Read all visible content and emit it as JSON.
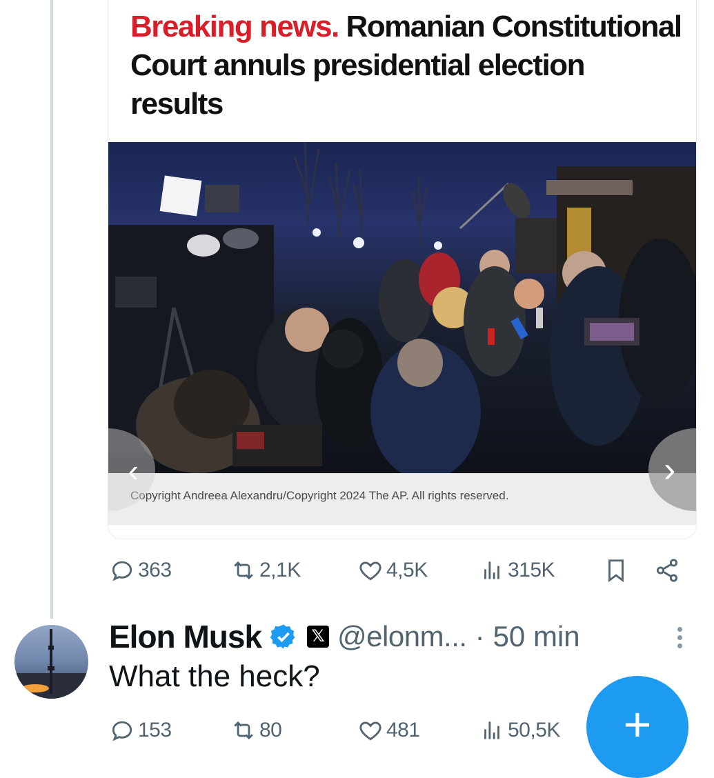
{
  "article": {
    "headline_accent": "Breaking news.",
    "headline_rest": " Romanian Constitutional Court annuls presidential election results",
    "caption": "Copyright Andreea Alexandru/Copyright 2024 The AP. All rights reserved."
  },
  "post_stats": {
    "replies": "363",
    "reposts": "2,1K",
    "likes": "4,5K",
    "views": "315K"
  },
  "reply": {
    "name": "Elon Musk",
    "badge_letter": "𝕏",
    "handle": "@elonm...",
    "separator": "·",
    "time": "50 min",
    "text": "What the heck?",
    "stats": {
      "replies": "153",
      "reposts": "80",
      "likes": "481",
      "views": "50,5K"
    }
  },
  "fab": {
    "label": "+"
  },
  "colors": {
    "accent_red": "#d81e29",
    "twitter_blue": "#1d9bf0",
    "muted": "#536471"
  }
}
